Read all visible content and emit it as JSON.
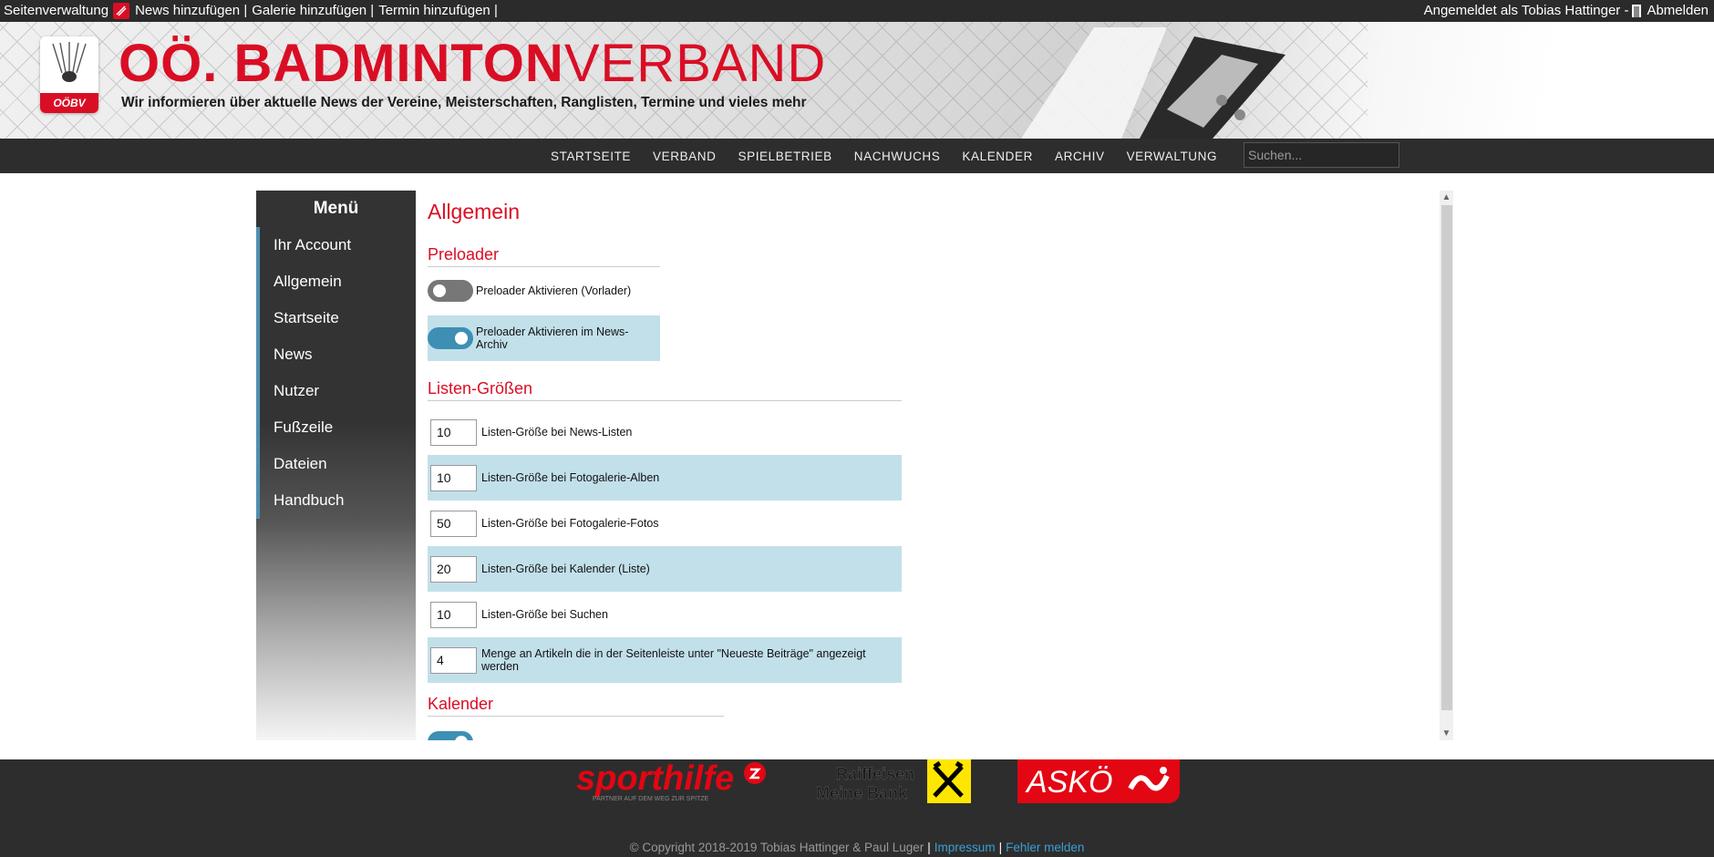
{
  "adminbar": {
    "site_admin": "Seitenverwaltung",
    "add_news": "News hinzufügen |",
    "add_gallery": "Galerie hinzufügen |",
    "add_event": "Termin hinzufügen |",
    "logged_in_as": "Angemeldet als Tobias Hattinger -",
    "logout": "Abmelden"
  },
  "header": {
    "title_bold": "OÖ. BADMINTON",
    "title_thin": "VERBAND",
    "tagline": "Wir informieren über aktuelle News der Vereine, Meisterschaften, Ranglisten, Termine und vieles mehr",
    "badge_text": "OÖBV"
  },
  "nav": {
    "items": [
      "STARTSEITE",
      "VERBAND",
      "SPIELBETRIEB",
      "NACHWUCHS",
      "KALENDER",
      "ARCHIV",
      "VERWALTUNG"
    ],
    "search_placeholder": "Suchen..."
  },
  "sidebar": {
    "title": "Menü",
    "items": [
      "Ihr Account",
      "Allgemein",
      "Startseite",
      "News",
      "Nutzer",
      "Fußzeile",
      "Dateien",
      "Handbuch"
    ]
  },
  "main": {
    "heading": "Allgemein",
    "preloader": {
      "title": "Preloader",
      "opt1": {
        "label": "Preloader Aktivieren (Vorlader)",
        "enabled": false
      },
      "opt2": {
        "label": "Preloader Aktivieren im News-Archiv",
        "enabled": true
      }
    },
    "lists": {
      "title": "Listen-Größen",
      "rows": [
        {
          "value": "10",
          "label": "Listen-Größe bei News-Listen"
        },
        {
          "value": "10",
          "label": "Listen-Größe bei Fotogalerie-Alben"
        },
        {
          "value": "50",
          "label": "Listen-Größe bei Fotogalerie-Fotos"
        },
        {
          "value": "20",
          "label": "Listen-Größe bei Kalender (Liste)"
        },
        {
          "value": "10",
          "label": "Listen-Größe bei Suchen"
        },
        {
          "value": "4",
          "label": "Menge an Artikeln die in der Seitenleiste unter \"Neueste Beiträge\" angezeigt werden"
        }
      ]
    },
    "calendar": {
      "title": "Kalender",
      "opt1": {
        "enabled": true
      }
    }
  },
  "footer": {
    "sponsor1": "sporthilfe",
    "sponsor1_tagline": "PARTNER AUF DEM WEG ZUR SPITZE",
    "sponsor2_line1": "Raiffeisen",
    "sponsor2_line2": "Meine Bank",
    "sponsor3": "ASKÖ",
    "copyright": "© Copyright 2018-2019 Tobias Hattinger & Paul Luger",
    "imprint": "Impressum",
    "report": "Fehler melden"
  }
}
